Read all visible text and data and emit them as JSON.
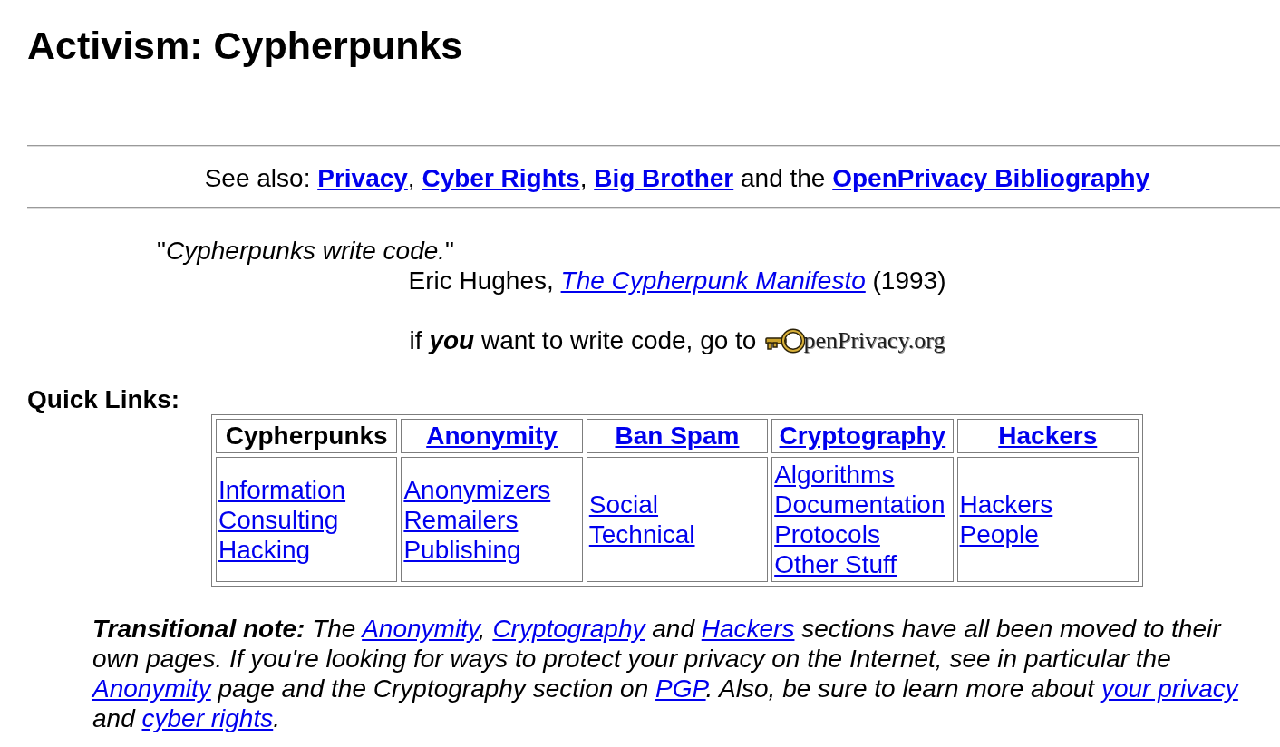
{
  "heading": "Activism: Cypherpunks",
  "see_also": {
    "lead": "See also:",
    "links": [
      {
        "text": "Privacy",
        "trail": ","
      },
      {
        "text": "Cyber Rights",
        "trail": ","
      },
      {
        "text": "Big Brother",
        "trail": " and the"
      },
      {
        "text": "OpenPrivacy Bibliography"
      }
    ]
  },
  "quote": "\"*Cypherpunks write code.*\"",
  "attribution": [
    {
      "kind": "text",
      "text": "Eric Hughes, "
    },
    {
      "kind": "link",
      "text": "The Cypherpunk Manifesto"
    },
    {
      "kind": "text",
      "text": " (1993)"
    }
  ],
  "invitation": {
    "text": "if **you** want to write code, go to",
    "logo": "penPrivacy.org"
  },
  "quick_links": {
    "label": "Quick Links:",
    "columns": [
      {
        "heading": "Cypherpunks",
        "selected": true,
        "items": [
          "Information",
          "Consulting",
          "Hacking"
        ]
      },
      {
        "heading": "Anonymity",
        "selected": false,
        "items": [
          "Anonymizers",
          "Remailers",
          "Publishing"
        ]
      },
      {
        "heading": "Ban Spam",
        "selected": false,
        "items": [
          "Social",
          "Technical"
        ]
      },
      {
        "heading": "Cryptography",
        "selected": false,
        "items": [
          "Algorithms",
          "Documentation",
          "Protocols",
          "Other Stuff"
        ]
      },
      {
        "heading": "Hackers",
        "selected": false,
        "items": [
          "Hackers",
          "People"
        ]
      }
    ]
  },
  "transitional_note": [
    {
      "kind": "bold",
      "text": "Transitional note:"
    },
    {
      "kind": "text",
      "text": " The "
    },
    {
      "kind": "link",
      "text": "Anonymity"
    },
    {
      "kind": "text",
      "text": ", "
    },
    {
      "kind": "link",
      "text": "Cryptography"
    },
    {
      "kind": "text",
      "text": " and "
    },
    {
      "kind": "link",
      "text": "Hackers"
    },
    {
      "kind": "text",
      "text": " sections have all been moved to their own pages. If you're looking for ways to protect your privacy on the Internet, see in particular the "
    },
    {
      "kind": "link",
      "text": "Anonymity"
    },
    {
      "kind": "text",
      "text": " page and the Cryptography section on "
    },
    {
      "kind": "link",
      "text": "PGP"
    },
    {
      "kind": "text",
      "text": ". Also, be sure to learn more about "
    },
    {
      "kind": "link",
      "text": "your privacy"
    },
    {
      "kind": "text",
      "text": " and "
    },
    {
      "kind": "link",
      "text": "cyber rights"
    },
    {
      "kind": "text",
      "text": "."
    }
  ]
}
